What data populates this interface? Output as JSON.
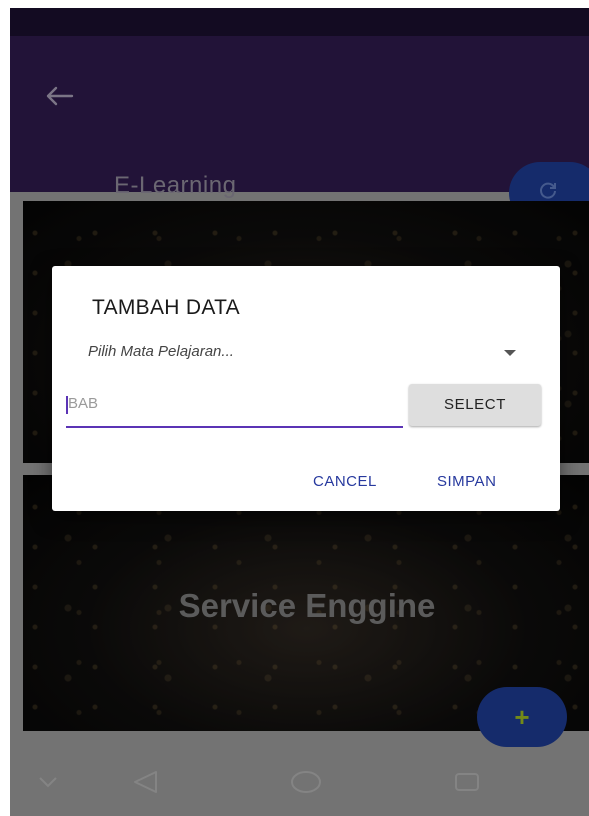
{
  "app_bar": {
    "title": "E-Learning",
    "back_icon": "arrow-left-icon",
    "refresh_icon": "refresh-icon"
  },
  "cards": [
    {
      "title": ""
    },
    {
      "title": "Service Enggine"
    }
  ],
  "fab": {
    "label": "+",
    "icon": "plus-icon"
  },
  "dialog": {
    "title": "TAMBAH DATA",
    "subject_select": {
      "selected": "Pilih Mata Pelajaran..."
    },
    "bab_input": {
      "value": "",
      "placeholder": "BAB"
    },
    "select_button": "SELECT",
    "cancel_button": "CANCEL",
    "save_button": "SIMPAN"
  },
  "nav_bar": {
    "icons": [
      "chevron-down-icon",
      "back-triangle-icon",
      "home-circle-icon",
      "recents-square-icon"
    ]
  },
  "colors": {
    "status_bar": "#1a0f2e",
    "app_bar": "#2e1a4b",
    "fab": "#1d3a8f",
    "accent": "#5b34b5",
    "dialog_action": "#27399e"
  }
}
